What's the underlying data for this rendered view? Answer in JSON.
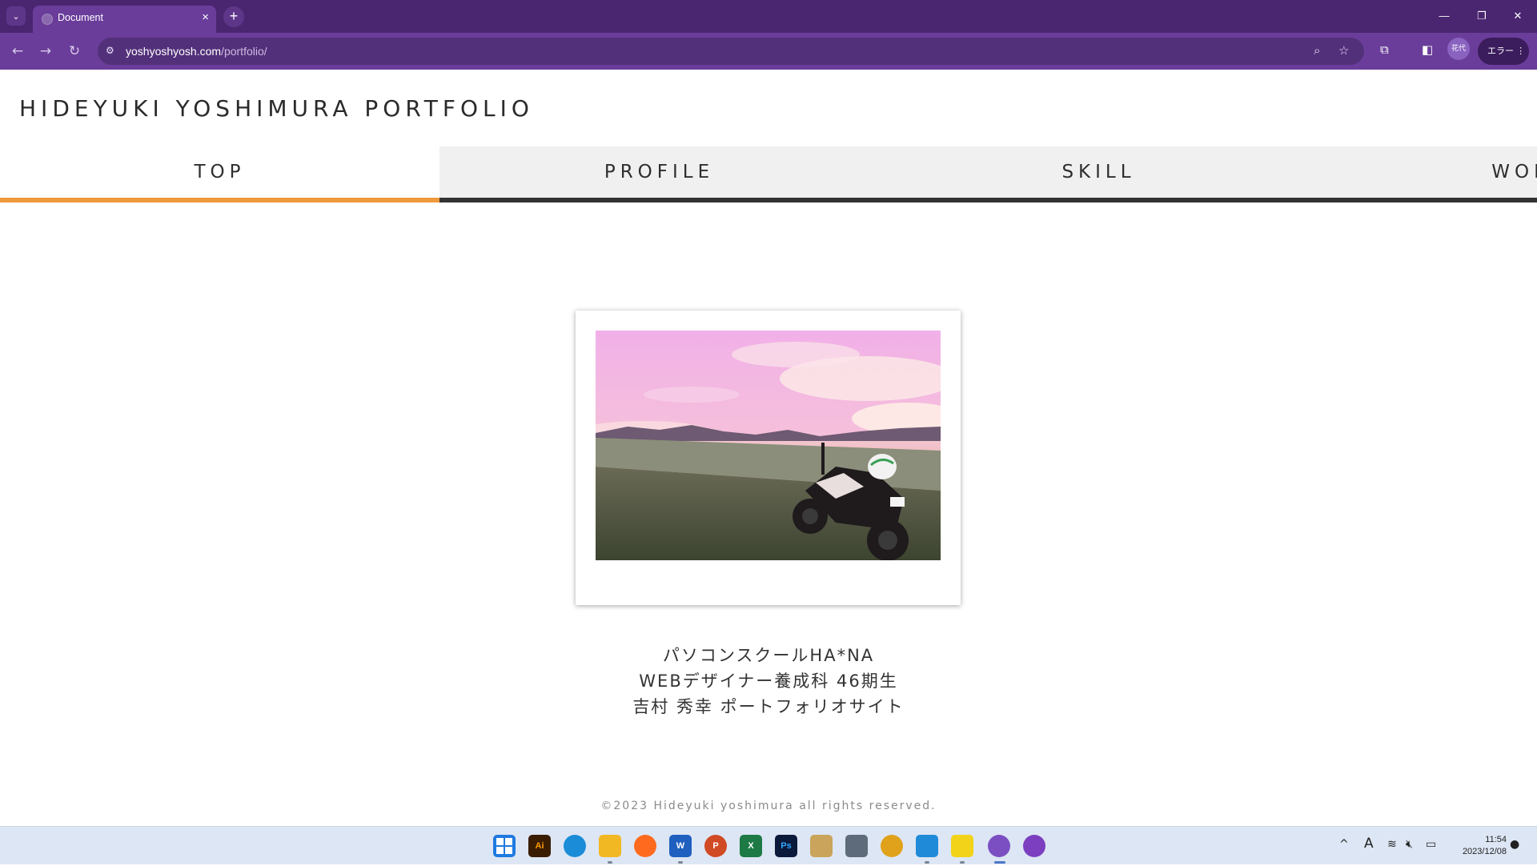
{
  "browser": {
    "tab_title": "Document",
    "tab_close": "×",
    "new_tab": "+",
    "url_host": "yoshyoshyosh.com",
    "url_path": "/portfolio/",
    "profile_label": "花代",
    "error_label": "エラー",
    "window_controls": {
      "minimize": "—",
      "restore": "❐",
      "close": "✕"
    },
    "icons": [
      "tab-list-icon",
      "back-icon",
      "forward-icon",
      "reload-icon",
      "site-info-icon",
      "zoom-icon",
      "bookmark-star-icon",
      "extensions-icon",
      "side-panel-icon",
      "more-menu-icon"
    ]
  },
  "site": {
    "title": "HIDEYUKI YOSHIMURA PORTFOLIO",
    "nav": [
      {
        "label": "TOP",
        "active": true
      },
      {
        "label": "PROFILE",
        "active": false
      },
      {
        "label": "SKILL",
        "active": false
      },
      {
        "label": "WORKS",
        "active": false
      }
    ],
    "hero_image": "motorcycle-at-seaside-sunset-photo",
    "caption_lines": [
      "パソコンスクールHA*NA",
      "WEBデザイナー養成科 46期生",
      "吉村 秀幸 ポートフォリオサイト"
    ],
    "footer": "©2023 Hideyuki yoshimura all rights reserved.",
    "colors": {
      "accent": "#f0983c",
      "nav_border": "#333333",
      "nav_bg": "#f0f0f0"
    }
  },
  "taskbar": {
    "apps": [
      {
        "name": "windows-start-icon",
        "label": "",
        "color": "#1f7ae0"
      },
      {
        "name": "illustrator-icon",
        "label": "Ai",
        "color": "#3a1d00"
      },
      {
        "name": "edge-icon",
        "label": "",
        "color": "#1a8cd8"
      },
      {
        "name": "file-explorer-icon",
        "label": "",
        "color": "#f2b824"
      },
      {
        "name": "firefox-icon",
        "label": "",
        "color": "#ff6a1f"
      },
      {
        "name": "word-icon",
        "label": "W",
        "color": "#1f5fbf"
      },
      {
        "name": "powerpoint-icon",
        "label": "P",
        "color": "#d04a24"
      },
      {
        "name": "excel-icon",
        "label": "X",
        "color": "#1d7a45"
      },
      {
        "name": "photoshop-icon",
        "label": "Ps",
        "color": "#0b1a3a"
      },
      {
        "name": "paint-icon",
        "label": "",
        "color": "#c9a45a"
      },
      {
        "name": "calculator-icon",
        "label": "",
        "color": "#5d6b7a"
      },
      {
        "name": "chrome-icon",
        "label": "",
        "color": "#e0a21a"
      },
      {
        "name": "vscode-icon",
        "label": "",
        "color": "#1f8ad8"
      },
      {
        "name": "sticky-notes-icon",
        "label": "",
        "color": "#f2d31a"
      },
      {
        "name": "chrome-profile-icon",
        "label": "",
        "color": "#7b4fc2"
      },
      {
        "name": "github-desktop-icon",
        "label": "",
        "color": "#7b3fc0"
      }
    ],
    "tray": {
      "chevron": "^",
      "ime": "A",
      "wifi": "wifi-icon",
      "volume": "volume-muted-icon",
      "battery": "battery-icon",
      "notification": "notification-bell-icon"
    },
    "time": "11:54",
    "date": "2023/12/08"
  }
}
